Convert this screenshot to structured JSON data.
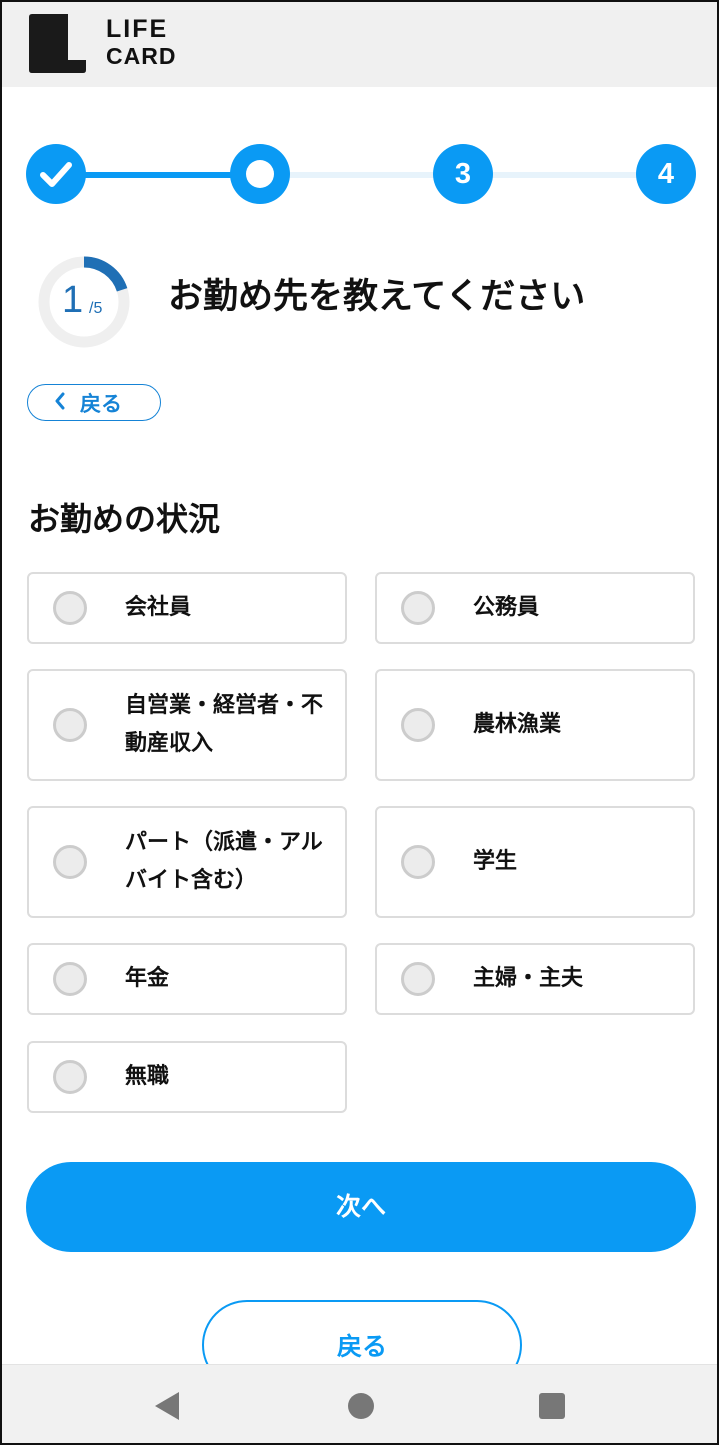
{
  "header": {
    "brand_line1": "LIFE",
    "brand_line2": "CARD"
  },
  "stepper": {
    "steps": [
      {
        "label": "",
        "state": "completed",
        "icon": "check-icon"
      },
      {
        "label": "",
        "state": "current"
      },
      {
        "label": "3",
        "state": "upcoming"
      },
      {
        "label": "4",
        "state": "upcoming"
      }
    ]
  },
  "progress": {
    "current": "1",
    "total": "/5",
    "fraction": 0.2
  },
  "page": {
    "title": "お勤め先を教えてください",
    "back_small_label": "戻る",
    "back_small_icon": "chevron-left-icon"
  },
  "employment": {
    "section_title": "お勤めの状況",
    "options": [
      {
        "label": "会社員",
        "selected": false
      },
      {
        "label": "公務員",
        "selected": false
      },
      {
        "label": "自営業・経営者・不動産収入",
        "selected": false
      },
      {
        "label": "農林漁業",
        "selected": false
      },
      {
        "label": "パート（派遣・アルバイト含む）",
        "selected": false
      },
      {
        "label": "学生",
        "selected": false
      },
      {
        "label": "年金",
        "selected": false
      },
      {
        "label": "主婦・主夫",
        "selected": false
      },
      {
        "label": "無職",
        "selected": false
      }
    ]
  },
  "actions": {
    "next_label": "次へ",
    "back_label": "戻る"
  },
  "colors": {
    "accent": "#0a9af4",
    "link": "#1583d6",
    "ring": "#1f6fb5",
    "border": "#dcdcdc"
  },
  "system_nav": {
    "icons": [
      "back-triangle-icon",
      "home-circle-icon",
      "recents-square-icon"
    ]
  }
}
